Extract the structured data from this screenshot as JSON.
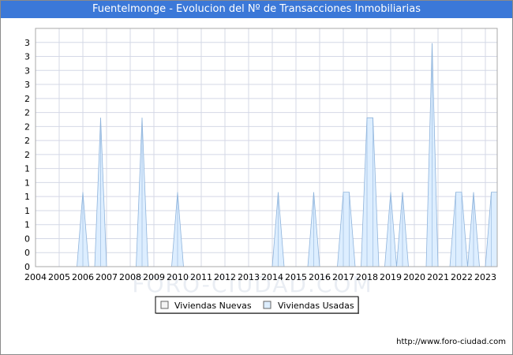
{
  "title": "Fuentelmonge - Evolucion del Nº de Transacciones Inmobiliarias",
  "source": "http://www.foro-ciudad.com",
  "watermark": "FORO-CIUDAD.COM",
  "colors": {
    "titlebar": "#3b78d8",
    "usadas_fill": "#ddeeff",
    "usadas_line": "#8fb4dc",
    "nuevas_fill": "#f4f4f4",
    "grid": "#d4d8e6"
  },
  "chart_data": {
    "type": "area",
    "title": "Fuentelmonge - Evolucion del Nº de Transacciones Inmobiliarias",
    "xlabel": "",
    "ylabel": "",
    "x_ticks": [
      "2004",
      "2005",
      "2006",
      "2007",
      "2008",
      "2009",
      "2010",
      "2011",
      "2012",
      "2013",
      "2014",
      "2015",
      "2016",
      "2017",
      "2018",
      "2019",
      "2020",
      "2021",
      "2022",
      "2023"
    ],
    "y_tick_labels": [
      "0",
      "0",
      "0",
      "1",
      "1",
      "1",
      "1",
      "1",
      "2",
      "2",
      "2",
      "2",
      "2",
      "3",
      "3",
      "3",
      "3"
    ],
    "xlim": [
      2004.0,
      2023.5
    ],
    "ylim": [
      0,
      3.2
    ],
    "grid": true,
    "legend": "bottom-center",
    "series": [
      {
        "name": "Viviendas Nuevas",
        "points": []
      },
      {
        "name": "Viviendas Usadas",
        "points": [
          [
            2005.75,
            0
          ],
          [
            2006.0,
            1
          ],
          [
            2006.25,
            0
          ],
          [
            2006.5,
            0
          ],
          [
            2006.75,
            2
          ],
          [
            2007.0,
            0
          ],
          [
            2008.25,
            0
          ],
          [
            2008.5,
            2
          ],
          [
            2008.75,
            0
          ],
          [
            2009.75,
            0
          ],
          [
            2010.0,
            1
          ],
          [
            2010.25,
            0
          ],
          [
            2014.0,
            0
          ],
          [
            2014.25,
            1
          ],
          [
            2014.5,
            0
          ],
          [
            2015.5,
            0
          ],
          [
            2015.75,
            1
          ],
          [
            2016.0,
            0
          ],
          [
            2016.75,
            0
          ],
          [
            2017.0,
            1
          ],
          [
            2017.25,
            1
          ],
          [
            2017.5,
            0
          ],
          [
            2017.75,
            0
          ],
          [
            2018.0,
            2
          ],
          [
            2018.25,
            2
          ],
          [
            2018.5,
            0
          ],
          [
            2018.75,
            0
          ],
          [
            2019.0,
            1
          ],
          [
            2019.25,
            0
          ],
          [
            2019.25,
            0
          ],
          [
            2019.5,
            1
          ],
          [
            2019.75,
            0
          ],
          [
            2020.5,
            0
          ],
          [
            2020.75,
            3
          ],
          [
            2021.0,
            0
          ],
          [
            2021.5,
            0
          ],
          [
            2021.75,
            1
          ],
          [
            2022.0,
            1
          ],
          [
            2022.25,
            0
          ],
          [
            2022.25,
            0
          ],
          [
            2022.5,
            1
          ],
          [
            2022.75,
            0
          ],
          [
            2023.0,
            0
          ],
          [
            2023.25,
            1
          ],
          [
            2023.5,
            1
          ]
        ]
      }
    ]
  }
}
